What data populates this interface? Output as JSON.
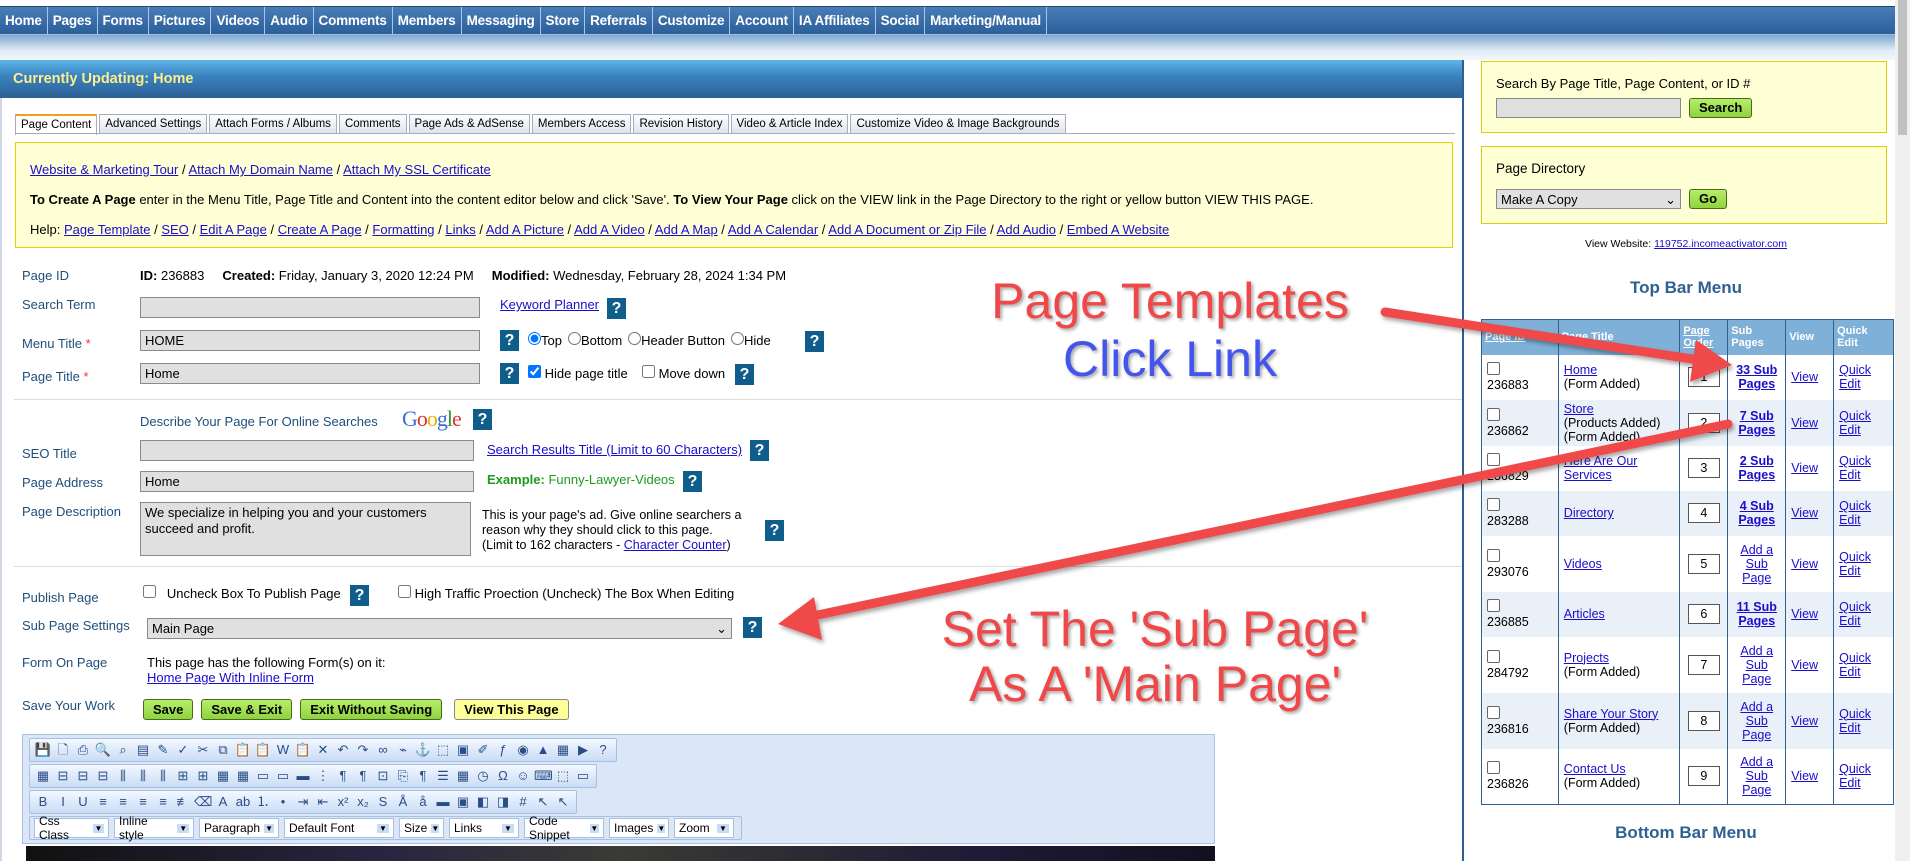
{
  "nav": [
    "Home",
    "Pages",
    "Forms",
    "Pictures",
    "Videos",
    "Audio",
    "Comments",
    "Members",
    "Messaging",
    "Store",
    "Referrals",
    "Customize",
    "Account",
    "IA Affiliates",
    "Social",
    "Marketing/Manual"
  ],
  "header": {
    "title": "Currently Updating: Home"
  },
  "tabs": [
    "Page Content",
    "Advanced Settings",
    "Attach Forms / Albums",
    "Comments",
    "Page Ads & AdSense",
    "Members Access",
    "Revision History",
    "Video & Article Index",
    "Customize Video & Image Backgrounds"
  ],
  "info": {
    "links": [
      "Website & Marketing Tour",
      "Attach My Domain Name",
      "Attach My SSL Certificate"
    ],
    "sep": " / ",
    "create_bold": "To Create A Page",
    "create_text": " enter in the Menu Title, Page Title and Content into the content editor below and click 'Save'. ",
    "view_bold": "To View Your Page",
    "view_text": " click on the VIEW link in the Page Directory to the right or yellow button VIEW THIS PAGE.",
    "help_label": "Help:",
    "help_links": [
      "Page Template",
      "SEO",
      "Edit A Page",
      "Create A Page",
      "Formatting",
      "Links",
      "Add A Picture",
      "Add A Video",
      "Add A Map",
      "Add A Calendar",
      "Add A Document or Zip File",
      "Add Audio",
      "Embed A Website"
    ]
  },
  "form": {
    "page_id_label": "Page ID",
    "id_label": "ID:",
    "id": "236883",
    "created_label": "Created:",
    "created": "Friday, January 3, 2020 12:24 PM",
    "modified_label": "Modified:",
    "modified": "Wednesday, February 28, 2024 1:34 PM",
    "search_term_label": "Search Term",
    "search_term": "",
    "keyword_planner": "Keyword Planner",
    "menu_title_label": "Menu Title",
    "required": "*",
    "menu_title": "HOME",
    "position_options": [
      "Top",
      "Bottom",
      "Header Button",
      "Hide"
    ],
    "position_selected": "Top",
    "page_title_label": "Page Title",
    "page_title": "Home",
    "hide_page_title": "Hide page title",
    "hide_page_title_checked": true,
    "move_down": "Move down",
    "move_down_checked": false,
    "describe": "Describe Your Page For Online Searches",
    "google_logo": "Google",
    "seo_title_label": "SEO Title",
    "seo_title": "",
    "seo_title_link": "Search Results Title (Limit to 60 Characters)",
    "page_address_label": "Page Address",
    "page_address": "Home",
    "example_label": "Example:",
    "example": "Funny-Lawyer-Videos",
    "page_description_label": "Page Description",
    "page_description": "We specialize in helping you and your customers succeed and profit.",
    "desc_help1": "This is your page's ad. Give online searchers a reason why they should click to this page.",
    "desc_help2": "(Limit to 162 characters - ",
    "char_counter": "Character Counter",
    "desc_help3": ")",
    "publish_label": "Publish Page",
    "publish_text": "Uncheck Box To Publish Page",
    "high_traffic": "High Traffic Proection (Uncheck) The Box When Editing",
    "subpage_label": "Sub Page Settings",
    "subpage_value": "Main Page",
    "form_on_page_label": "Form On Page",
    "form_on_page_text": "This page has the following Form(s) on it:",
    "form_link": "Home Page With Inline Form",
    "save_label": "Save Your Work",
    "buttons": {
      "save": "Save",
      "save_exit": "Save & Exit",
      "exit": "Exit Without Saving",
      "view": "View This Page"
    }
  },
  "editor": {
    "row1": [
      [
        "save-icon",
        "💾"
      ],
      [
        "new-document-icon",
        "🗋"
      ],
      [
        "print-icon",
        "⎙"
      ],
      [
        "preview-icon",
        "🔍"
      ],
      [
        "find-icon",
        "⌕"
      ],
      [
        "template-icon",
        "▤"
      ],
      [
        "clean-icon",
        "✎"
      ],
      [
        "spellcheck-icon",
        "✓"
      ],
      [
        "cut-icon",
        "✂"
      ],
      [
        "copy-icon",
        "⧉"
      ],
      [
        "paste-icon",
        "📋"
      ],
      [
        "paste-text-icon",
        "📋"
      ],
      [
        "paste-word-icon",
        "W"
      ],
      [
        "paste-html-icon",
        "📋"
      ],
      [
        "delete-icon",
        "✕"
      ],
      [
        "undo-icon",
        "↶"
      ],
      [
        "redo-icon",
        "↷"
      ],
      [
        "link-icon",
        "∞"
      ],
      [
        "unlink-icon",
        "⌁"
      ],
      [
        "anchor-icon",
        "⚓"
      ],
      [
        "select-icon",
        "⬚"
      ],
      [
        "image-icon",
        "▣"
      ],
      [
        "edit-image-icon",
        "✐"
      ],
      [
        "flash-icon",
        "ƒ"
      ],
      [
        "media-icon",
        "◉"
      ],
      [
        "pdf-icon",
        "▲"
      ],
      [
        "form-icon",
        "▦"
      ],
      [
        "youtube-icon",
        "▶"
      ],
      [
        "help-icon",
        "?"
      ]
    ],
    "row2": [
      [
        "table-icon",
        "▦"
      ],
      [
        "insert-row-icon",
        "⊟"
      ],
      [
        "insert-row-after-icon",
        "⊟"
      ],
      [
        "delete-row-icon",
        "⊟"
      ],
      [
        "insert-col-icon",
        "⫼"
      ],
      [
        "insert-col-after-icon",
        "⫼"
      ],
      [
        "delete-col-icon",
        "⫼"
      ],
      [
        "split-cell-icon",
        "⊞"
      ],
      [
        "merge-cell-icon",
        "⊞"
      ],
      [
        "cell-props-icon",
        "▦"
      ],
      [
        "table-props-icon",
        "▦"
      ],
      [
        "row-props-icon",
        "▭"
      ],
      [
        "col-props-icon",
        "▭"
      ],
      [
        "hidden-icon",
        "▬"
      ],
      [
        "break-icon",
        "⋮"
      ],
      [
        "ltr-icon",
        "¶"
      ],
      [
        "rtl-icon",
        "¶"
      ],
      [
        "page-break-icon",
        "⊡"
      ],
      [
        "snippet-icon",
        "⎘"
      ],
      [
        "paragraph-icon",
        "¶"
      ],
      [
        "hr-list-icon",
        "☰"
      ],
      [
        "date-icon",
        "▦"
      ],
      [
        "time-icon",
        "◷"
      ],
      [
        "special-char-icon",
        "Ω"
      ],
      [
        "emoticon-icon",
        "☺"
      ],
      [
        "keyboard-icon",
        "⌨"
      ],
      [
        "box-icon",
        "⬚"
      ],
      [
        "text-area-icon",
        "▭"
      ]
    ],
    "row3": [
      [
        "bold-icon",
        "B"
      ],
      [
        "italic-icon",
        "I"
      ],
      [
        "underline-icon",
        "U"
      ],
      [
        "align-left-icon",
        "≡"
      ],
      [
        "align-center-icon",
        "≡"
      ],
      [
        "align-right-icon",
        "≡"
      ],
      [
        "justify-icon",
        "≡"
      ],
      [
        "strikeline-icon",
        "≢"
      ],
      [
        "eraser-icon",
        "⌫"
      ],
      [
        "font-color-icon",
        "A"
      ],
      [
        "highlight-icon",
        "ab"
      ],
      [
        "ordered-list-icon",
        "⒈"
      ],
      [
        "unordered-list-icon",
        "•"
      ],
      [
        "indent-icon",
        "⇥"
      ],
      [
        "outdent-icon",
        "⇤"
      ],
      [
        "superscript-icon",
        "x²"
      ],
      [
        "subscript-icon",
        "x₂"
      ],
      [
        "strikethrough-icon",
        "S"
      ],
      [
        "upper-case-icon",
        "Å"
      ],
      [
        "lower-case-icon",
        "å"
      ],
      [
        "horizontal-rule-icon",
        "▬"
      ],
      [
        "absolute-position-icon",
        "▣"
      ],
      [
        "bring-forward-icon",
        "◧"
      ],
      [
        "send-backward-icon",
        "◨"
      ],
      [
        "grid-icon",
        "#"
      ],
      [
        "cursor-plus-icon",
        "↖"
      ],
      [
        "cursor-minus-icon",
        "↖"
      ]
    ],
    "dropdowns": [
      "Css Class",
      "Inline style",
      "Paragraph",
      "Default Font",
      "Size",
      "Links",
      "Code Snippet",
      "Images",
      "Zoom"
    ]
  },
  "sidebar": {
    "search_label": "Search By Page Title, Page Content, or ID #",
    "search_value": "",
    "search_button": "Search",
    "directory_label": "Page Directory",
    "directory_value": "Make A Copy",
    "go_button": "Go",
    "view_website_label": "View Website:",
    "view_website": "119752.incomeactivator.com",
    "top_bar_menu": "Top Bar Menu",
    "bottom_bar_menu": "Bottom Bar Menu",
    "columns": [
      "Page ID",
      "Page Title",
      "Page Order",
      "Sub Pages",
      "View",
      "Quick Edit"
    ],
    "rows": [
      {
        "id": "236883",
        "title": "Home",
        "notes": [
          "(Form Added)"
        ],
        "order": "1",
        "sub": "33 Sub Pages",
        "view": "View",
        "edit": "Quick Edit"
      },
      {
        "id": "236862",
        "title": "Store",
        "notes": [
          "(Products Added)",
          "(Form Added)"
        ],
        "order": "2",
        "sub": "7 Sub Pages",
        "view": "View",
        "edit": "Quick Edit"
      },
      {
        "id": "236829",
        "title": "Here Are Our Services",
        "notes": [],
        "order": "3",
        "sub": "2 Sub Pages",
        "view": "View",
        "edit": "Quick Edit"
      },
      {
        "id": "283288",
        "title": "Directory",
        "notes": [],
        "order": "4",
        "sub": "4 Sub Pages",
        "view": "View",
        "edit": "Quick Edit"
      },
      {
        "id": "293076",
        "title": "Videos",
        "notes": [],
        "order": "5",
        "sub": "Add a Sub Page",
        "view": "View",
        "edit": "Quick Edit"
      },
      {
        "id": "236885",
        "title": "Articles",
        "notes": [],
        "order": "6",
        "sub": "11 Sub Pages",
        "view": "View",
        "edit": "Quick Edit"
      },
      {
        "id": "284792",
        "title": "Projects",
        "notes": [
          "(Form Added)"
        ],
        "order": "7",
        "sub": "Add a Sub Page",
        "view": "View",
        "edit": "Quick Edit"
      },
      {
        "id": "236816",
        "title": "Share Your Story",
        "notes": [
          "(Form Added)"
        ],
        "order": "8",
        "sub": "Add a Sub Page",
        "view": "View",
        "edit": "Quick Edit"
      },
      {
        "id": "236826",
        "title": "Contact Us",
        "notes": [
          "(Form Added)"
        ],
        "order": "9",
        "sub": "Add a Sub Page",
        "view": "View",
        "edit": "Quick Edit"
      }
    ]
  },
  "annotations": {
    "line1": "Page Templates",
    "line2": "Click Link",
    "line3": "Set The 'Sub Page'",
    "line4": "As A 'Main Page'",
    "red": "#f04848",
    "blue": "#4455ee"
  },
  "colors": {
    "nav": "#2b5f9a",
    "help": "#0f5d8a",
    "green_button": "#8fd33e",
    "yellow_box": "#ffffd5"
  }
}
